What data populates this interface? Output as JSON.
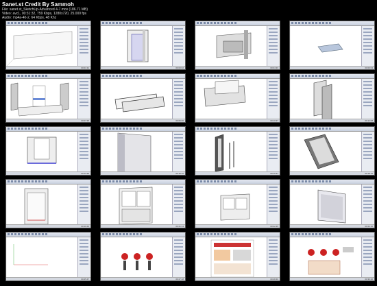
{
  "header": {
    "title": "Sanet.st Credit By Sammoh",
    "file": "File: sanet.st_SketchUp-Advanced 4-7.mov (186.71 MB)",
    "video": "Video: avc1, 00:31:32, 759 Kbps, 1280x720, 25.000 fps",
    "audio": "Audio: mp4a-40-2, 64 Kbps, 48 Khz"
  },
  "thumbnails": [
    {
      "index": 1,
      "timestamp": "00:01:31",
      "scene": "empty-room"
    },
    {
      "index": 2,
      "timestamp": "00:03:02",
      "scene": "door-frame"
    },
    {
      "index": 3,
      "timestamp": "00:04:33",
      "scene": "box-frame"
    },
    {
      "index": 4,
      "timestamp": "00:06:04",
      "scene": "flat-panel"
    },
    {
      "index": 5,
      "timestamp": "00:07:35",
      "scene": "context-menu-boards"
    },
    {
      "index": 6,
      "timestamp": "00:09:06",
      "scene": "two-boards"
    },
    {
      "index": 7,
      "timestamp": "00:10:37",
      "scene": "shelf-box"
    },
    {
      "index": 8,
      "timestamp": "00:12:08",
      "scene": "angled-panels"
    },
    {
      "index": 9,
      "timestamp": "00:13:39",
      "scene": "u-shape-frame"
    },
    {
      "index": 10,
      "timestamp": "00:15:10",
      "scene": "tall-panel"
    },
    {
      "index": 11,
      "timestamp": "00:16:41",
      "scene": "frame-and-rails"
    },
    {
      "index": 12,
      "timestamp": "00:18:12",
      "scene": "tilted-frame"
    },
    {
      "index": 13,
      "timestamp": "00:19:43",
      "scene": "cabinet-door"
    },
    {
      "index": 14,
      "timestamp": "00:21:14",
      "scene": "cabinet-two-doors"
    },
    {
      "index": 15,
      "timestamp": "00:22:45",
      "scene": "cabinet-small"
    },
    {
      "index": 16,
      "timestamp": "00:24:16",
      "scene": "panel-perspective"
    },
    {
      "index": 17,
      "timestamp": "00:25:47",
      "scene": "blank-axis"
    },
    {
      "index": 18,
      "timestamp": "00:27:18",
      "scene": "clamp-diagram"
    },
    {
      "index": 19,
      "timestamp": "00:28:49",
      "scene": "document-overlay"
    },
    {
      "index": 20,
      "timestamp": "00:30:20",
      "scene": "clamp-diagram-2"
    }
  ]
}
